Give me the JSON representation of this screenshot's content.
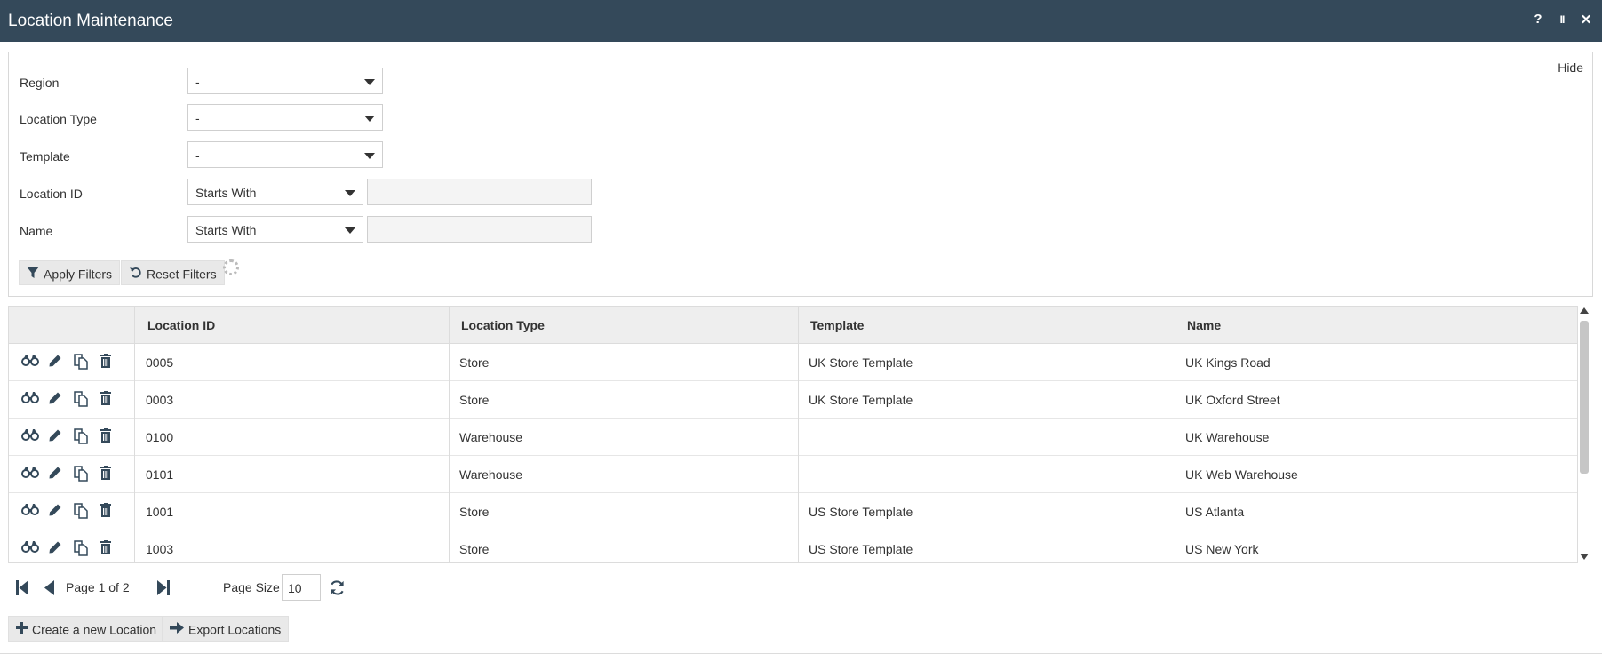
{
  "window": {
    "title": "Location Maintenance",
    "help_label": "?",
    "pause_label": "II",
    "close_label": "✕"
  },
  "filters": {
    "hide_label": "Hide",
    "region": {
      "label": "Region",
      "value": "-"
    },
    "location_type": {
      "label": "Location Type",
      "value": "-"
    },
    "template": {
      "label": "Template",
      "value": "-"
    },
    "location_id": {
      "label": "Location ID",
      "operator": "Starts With",
      "value": ""
    },
    "name": {
      "label": "Name",
      "operator": "Starts With",
      "value": ""
    },
    "apply_label": "Apply Filters",
    "reset_label": "Reset Filters"
  },
  "grid": {
    "columns": [
      "Location ID",
      "Location Type",
      "Template",
      "Name"
    ],
    "rows": [
      {
        "id": "0005",
        "type": "Store",
        "template": "UK Store Template",
        "name": "UK Kings Road"
      },
      {
        "id": "0003",
        "type": "Store",
        "template": "UK Store Template",
        "name": "UK Oxford Street"
      },
      {
        "id": "0100",
        "type": "Warehouse",
        "template": "",
        "name": "UK Warehouse"
      },
      {
        "id": "0101",
        "type": "Warehouse",
        "template": "",
        "name": "UK Web Warehouse"
      },
      {
        "id": "1001",
        "type": "Store",
        "template": "US Store Template",
        "name": "US Atlanta"
      },
      {
        "id": "1003",
        "type": "Store",
        "template": "US Store Template",
        "name": "US New York"
      }
    ],
    "row_actions": [
      "view-icon",
      "edit-icon",
      "copy-icon",
      "delete-icon"
    ]
  },
  "pager": {
    "page_text": "Page 1 of 2",
    "page_size_label": "Page Size",
    "page_size_value": "10"
  },
  "actions": {
    "create_label": "Create a new Location",
    "export_label": "Export Locations"
  },
  "colors": {
    "titlebar": "#34495a",
    "header_bg": "#eeeeee",
    "button_bg": "#e9e9e9"
  }
}
